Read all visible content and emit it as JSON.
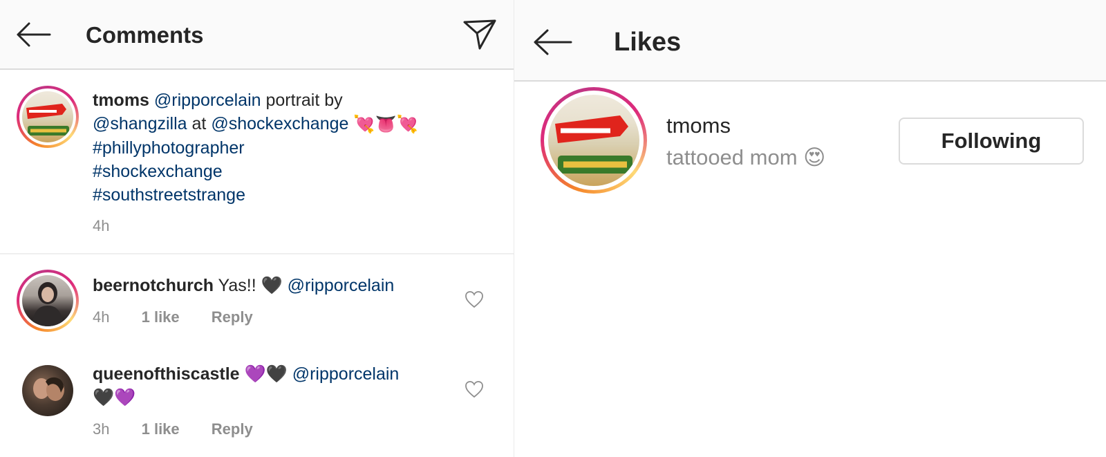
{
  "comments_panel": {
    "title": "Comments",
    "post": {
      "username": "tmoms",
      "mention1": "@ripporcelain",
      "text1": " portrait by",
      "mention2": "@shangzilla",
      "text2": " at ",
      "mention3": "@shockexchange",
      "emojis": "💘👅💘",
      "hashtags": [
        "#phillyphotographer",
        "#shockexchange",
        "#southstreetstrange"
      ],
      "time": "4h"
    },
    "comments": [
      {
        "username": "beernotchurch",
        "text": " Yas!! 🖤 ",
        "mention": "@ripporcelain",
        "time": "4h",
        "likes": "1 like",
        "reply": "Reply"
      },
      {
        "username": "queenofthiscastle",
        "text": " 💜🖤 ",
        "mention": "@ripporcelain",
        "text_after": "🖤💜",
        "time": "3h",
        "likes": "1 like",
        "reply": "Reply"
      }
    ]
  },
  "likes_panel": {
    "title": "Likes",
    "user": {
      "username": "tmoms",
      "bio": "tattooed mom 😍",
      "button": "Following"
    }
  }
}
